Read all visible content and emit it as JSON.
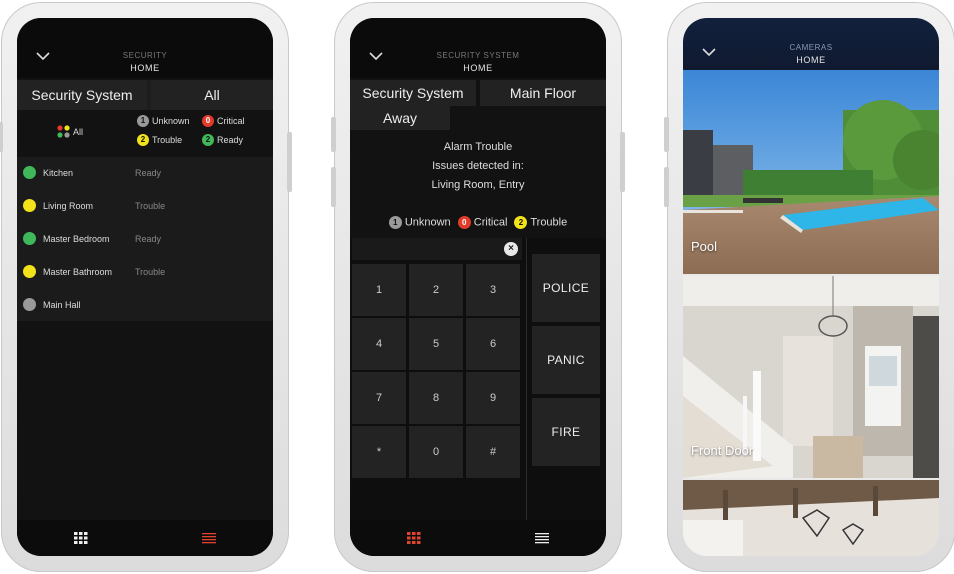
{
  "colors": {
    "green": "#3fb85a",
    "yellow": "#f1e21a",
    "red": "#e23b2a",
    "grey": "#9a9a9a",
    "accent": "#e0432f"
  },
  "screen1": {
    "header": {
      "sub": "SECURITY",
      "main": "HOME"
    },
    "tabs": [
      "Security System",
      "All"
    ],
    "legend": {
      "all": "All",
      "unknown": {
        "count": "1",
        "label": "Unknown"
      },
      "critical": {
        "count": "0",
        "label": "Critical"
      },
      "trouble": {
        "count": "2",
        "label": "Trouble"
      },
      "ready": {
        "count": "2",
        "label": "Ready"
      }
    },
    "rooms": [
      {
        "name": "Kitchen",
        "status": "Ready",
        "color": "#3fb85a"
      },
      {
        "name": "Living Room",
        "status": "Trouble",
        "color": "#f1e21a"
      },
      {
        "name": "Master Bedroom",
        "status": "Ready",
        "color": "#3fb85a"
      },
      {
        "name": "Master Bathroom",
        "status": "Trouble",
        "color": "#f1e21a"
      },
      {
        "name": "Main Hall",
        "status": "",
        "color": "#9a9a9a"
      }
    ]
  },
  "screen2": {
    "header": {
      "sub": "SECURITY SYSTEM",
      "main": "HOME"
    },
    "tabs": [
      "Security System",
      "Main Floor",
      "Away"
    ],
    "status": [
      "Alarm Trouble",
      "Issues detected in:",
      "Living Room, Entry"
    ],
    "legend": {
      "unknown": {
        "count": "1",
        "label": "Unknown"
      },
      "critical": {
        "count": "0",
        "label": "Critical"
      },
      "trouble": {
        "count": "2",
        "label": "Trouble"
      }
    },
    "clear_icon": "×",
    "keys": [
      "1",
      "2",
      "3",
      "4",
      "5",
      "6",
      "7",
      "8",
      "9",
      "*",
      "0",
      "#"
    ],
    "big_keys": [
      "POLICE",
      "PANIC",
      "FIRE"
    ]
  },
  "screen3": {
    "header": {
      "sub": "CAMERAS",
      "main": "HOME"
    },
    "cameras": [
      "Pool",
      "Front Door"
    ]
  }
}
